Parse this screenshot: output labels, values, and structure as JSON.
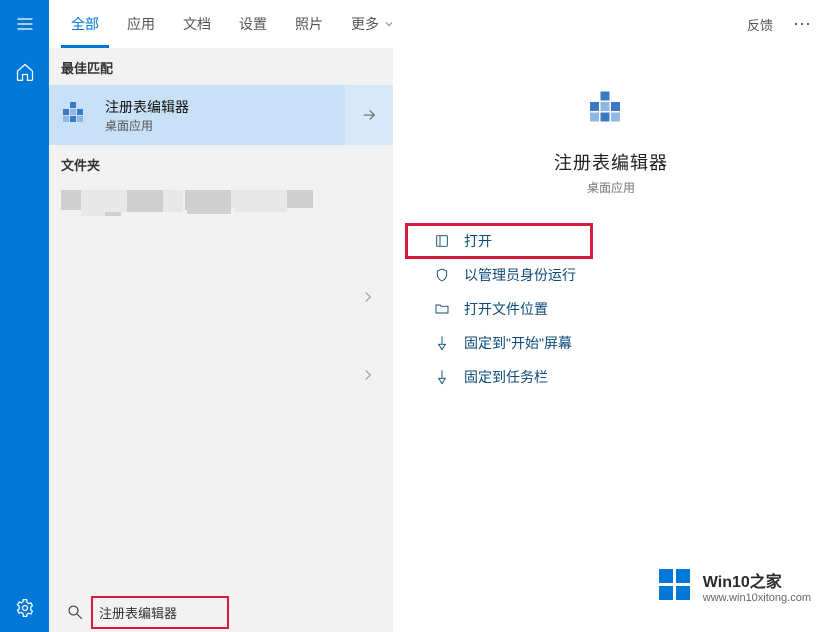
{
  "tabs": {
    "items": [
      {
        "label": "全部",
        "active": true
      },
      {
        "label": "应用"
      },
      {
        "label": "文档"
      },
      {
        "label": "设置"
      },
      {
        "label": "照片"
      },
      {
        "label": "更多",
        "hasChevron": true
      }
    ],
    "feedback": "反馈"
  },
  "sections": {
    "best_match_header": "最佳匹配",
    "folder_header": "文件夹"
  },
  "best_match": {
    "title": "注册表编辑器",
    "subtitle": "桌面应用"
  },
  "detail": {
    "title": "注册表编辑器",
    "subtitle": "桌面应用",
    "actions": [
      {
        "key": "open",
        "label": "打开",
        "icon": "open-icon",
        "highlight": true
      },
      {
        "key": "admin",
        "label": "以管理员身份运行",
        "icon": "shield-icon"
      },
      {
        "key": "loc",
        "label": "打开文件位置",
        "icon": "folder-icon"
      },
      {
        "key": "pinstart",
        "label": "固定到\"开始\"屏幕",
        "icon": "pin-icon"
      },
      {
        "key": "pintaskbar",
        "label": "固定到任务栏",
        "icon": "pin-icon"
      }
    ]
  },
  "search": {
    "value": "注册表编辑器"
  },
  "watermark": {
    "title": "Win10之家",
    "url": "www.win10xitong.com"
  }
}
